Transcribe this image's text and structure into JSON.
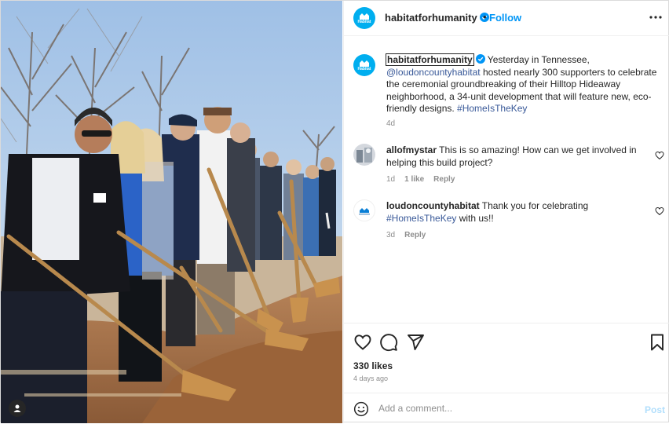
{
  "post": {
    "username": "habitatforhumanity",
    "avatar_text": "Habitat",
    "follow_label": "Follow",
    "dot": "•",
    "more_icon": "more-horizontal-icon",
    "caption": {
      "username": "habitatforhumanity",
      "text_1": "Yesterday in Tennessee, ",
      "mention": "@loudoncountyhabitat",
      "text_2": " hosted nearly 300 supporters to celebrate the ceremonial groundbreaking of their Hilltop Hideaway neighborhood, a 34-unit development that will feature new, eco-friendly designs. ",
      "hashtag": "#HomeIsTheKey",
      "time": "4d"
    },
    "comments": [
      {
        "username": "allofmystar",
        "text": "This is so amazing! How can we get involved in helping this build project?",
        "time": "1d",
        "likes": "1 like",
        "reply_label": "Reply"
      },
      {
        "username": "loudoncountyhabitat",
        "text_1": "Thank you for celebrating ",
        "hashtag": "#HomeIsTheKey",
        "text_2": " with us!!",
        "time": "3d",
        "reply_label": "Reply"
      }
    ],
    "likes_count": "330 likes",
    "posted_ago": "4 days ago",
    "add_comment_placeholder": "Add a comment...",
    "post_label": "Post",
    "colors": {
      "link": "#0095f6",
      "brand": "#00aeef",
      "muted": "#8e8e8e",
      "post_disabled": "#b2dffc"
    }
  }
}
